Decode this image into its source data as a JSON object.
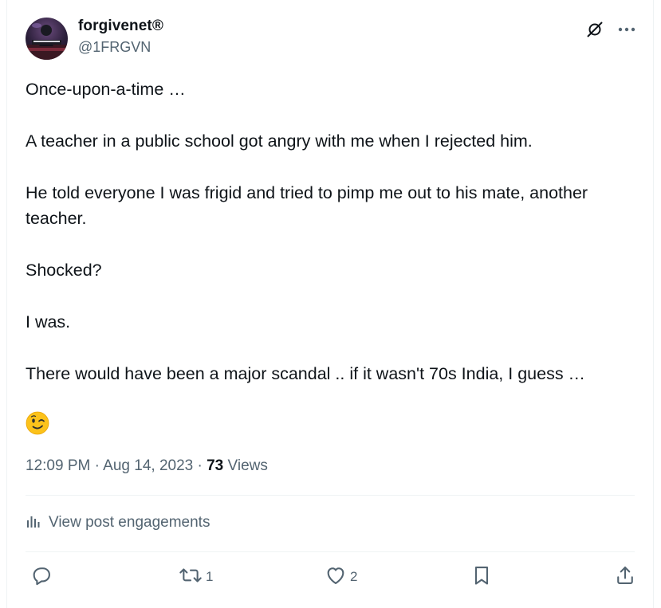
{
  "user": {
    "display_name": "forgivenet®",
    "handle": "@1FRGVN"
  },
  "tweet": {
    "paragraphs": [
      "Once-upon-a-time …",
      "A teacher in a public school got angry with me when I rejected him.",
      "He told everyone I was frigid and tried to pimp me out to his mate, another teacher.",
      "Shocked?",
      "I was.",
      "There would have been a major scandal .. if it wasn't 70s India, I guess …"
    ],
    "emoji": "winking-face"
  },
  "meta": {
    "time": "12:09 PM",
    "separator": "·",
    "date": "Aug 14, 2023",
    "views_count": "73",
    "views_label": "Views"
  },
  "engagements_label": "View post engagements",
  "actions": {
    "reply_count": "",
    "retweet_count": "1",
    "like_count": "2"
  },
  "colors": {
    "text": "#0f1419",
    "secondary": "#536471",
    "divider": "#eff3f4"
  }
}
